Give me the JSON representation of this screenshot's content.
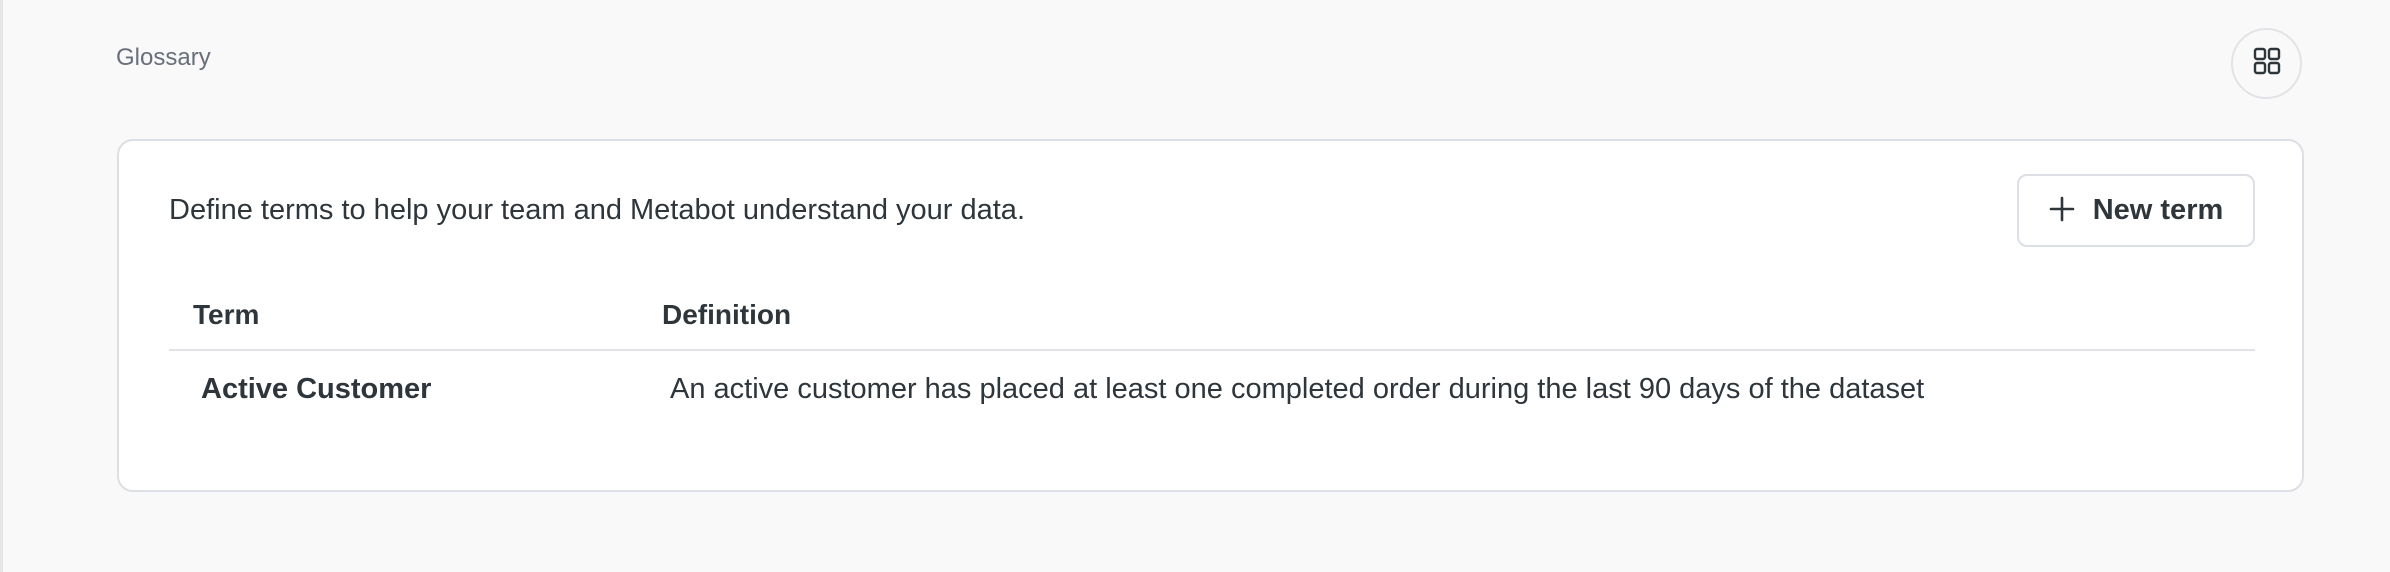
{
  "header": {
    "breadcrumb": "Glossary",
    "layout_button_icon": "grid-icon"
  },
  "glossary": {
    "description": "Define terms to help your team and Metabot understand your data.",
    "new_term_label": "New term",
    "new_term_icon": "plus-icon",
    "columns": [
      "Term",
      "Definition"
    ],
    "rows": [
      {
        "term": "Active Customer",
        "definition": "An active customer has placed at least one completed order during the last 90 days of the dataset"
      }
    ]
  },
  "colors": {
    "background": "#f9f9f9",
    "card": "#ffffff",
    "border": "#dcdfe3",
    "text": "#2e353b",
    "muted_text": "#696e7b"
  }
}
